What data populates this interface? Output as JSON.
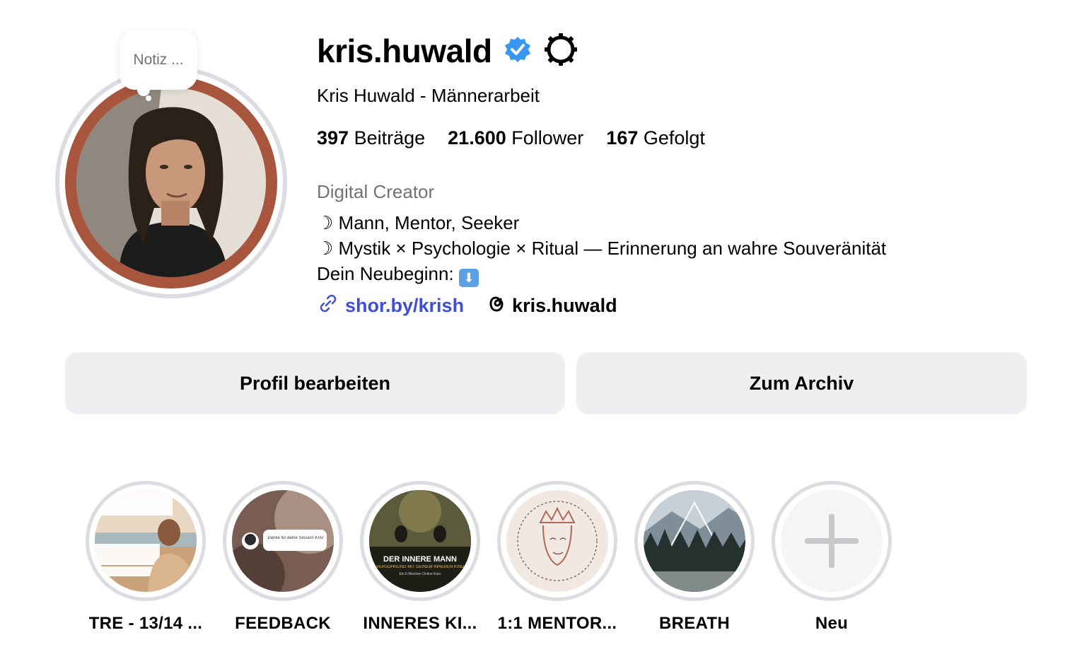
{
  "note": {
    "label": "Notiz ..."
  },
  "profile": {
    "username": "kris.huwald",
    "full_name": "Kris Huwald - Männerarbeit",
    "verified": true
  },
  "stats": {
    "posts_count": "397",
    "posts_label": "Beiträge",
    "followers_count": "21.600",
    "followers_label": "Follower",
    "following_count": "167",
    "following_label": "Gefolgt"
  },
  "bio": {
    "category": "Digital Creator",
    "line1": "☽ Mann, Mentor, Seeker",
    "line2": "☽ Mystik × Psychologie × Ritual — Erinnerung an wahre Souveränität",
    "line3": "Dein Neubeginn: ",
    "line3_emoji": "⬇"
  },
  "links": {
    "website": "shor.by/krish",
    "threads": "kris.huwald"
  },
  "buttons": {
    "edit_profile": "Profil bearbeiten",
    "archive": "Zum Archiv"
  },
  "highlights": [
    {
      "label": "TRE - 13/14 ...",
      "icon": "photo-man-beach"
    },
    {
      "label": "FEEDBACK",
      "icon": "photo-chat-bubble",
      "image_text": "Danke für deine Session Kris!"
    },
    {
      "label": "INNERES KI...",
      "icon": "photo-forest-meditation",
      "image_text_title": "DER INNERE MANN",
      "image_text_sub": "VERSÖHNUNG MIT DEINEM INNEREN KIND",
      "image_text_small": "Ein 6-Wochen Online-Kurs"
    },
    {
      "label": "1:1 MENTOR...",
      "icon": "illustration-king-face"
    },
    {
      "label": "BREATH",
      "icon": "photo-forest-triangle"
    },
    {
      "label": "Neu",
      "icon": "plus-icon"
    }
  ],
  "colors": {
    "link_blue": "#3d4fd6",
    "verified_blue": "#3897f0",
    "avatar_border": "#a8553e",
    "button_bg": "#efeff2",
    "muted_text": "#737373"
  }
}
